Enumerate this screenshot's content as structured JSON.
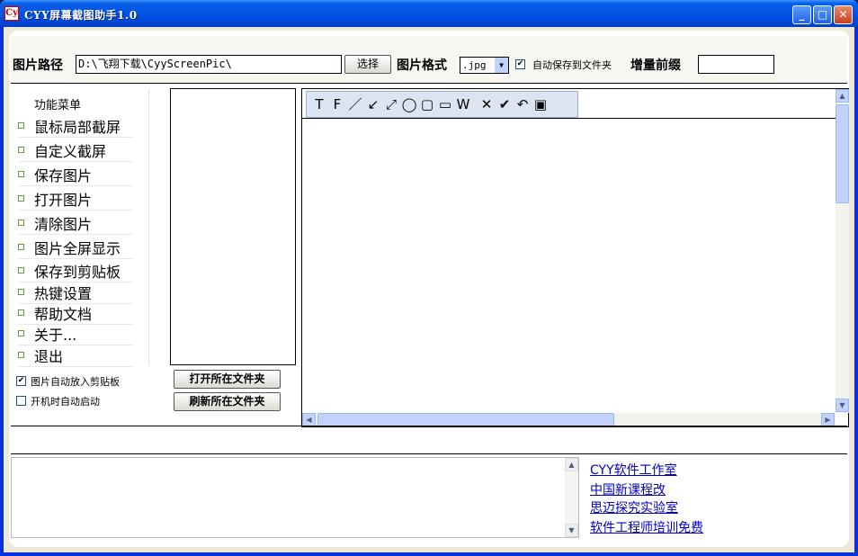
{
  "window": {
    "title": "CYY屏幕截图助手1.0"
  },
  "topbar": {
    "path_label": "图片路径",
    "path_value": "D:\\飞翔下载\\CyyScreenPic\\",
    "browse_button": "选择",
    "format_label": "图片格式",
    "format_value": ".jpg",
    "autosave_label": "自动保存到文件夹",
    "autosave_checked": true,
    "prefix_label": "增量前缀",
    "prefix_value": ""
  },
  "menu": {
    "title": "功能菜单",
    "items": [
      "鼠标局部截屏",
      "自定义截屏",
      "保存图片",
      "打开图片",
      "清除图片",
      "图片全屏显示",
      "保存到剪贴板",
      "热键设置",
      "帮助文档",
      "关于...",
      "退出"
    ]
  },
  "options": {
    "auto_clipboard": {
      "label": "图片自动放入剪贴板",
      "checked": true
    },
    "autostart": {
      "label": "开机时自动启动",
      "checked": false
    }
  },
  "folder_buttons": {
    "open": "打开所在文件夹",
    "refresh": "刷新所在文件夹"
  },
  "toolbar": {
    "tools": [
      {
        "name": "text-tool-icon",
        "glyph": "T"
      },
      {
        "name": "font-tool-icon",
        "glyph": "F"
      },
      {
        "name": "line-tool-icon",
        "glyph": "／"
      },
      {
        "name": "arrow-down-left-tool-icon",
        "glyph": "↙"
      },
      {
        "name": "double-arrow-tool-icon",
        "glyph": "⤢"
      },
      {
        "name": "ellipse-tool-icon",
        "glyph": "◯"
      },
      {
        "name": "rounded-rect-tool-icon",
        "glyph": "▢"
      },
      {
        "name": "rectangle-tool-icon",
        "glyph": "▭"
      },
      {
        "name": "line-width-tool-icon",
        "glyph": "W"
      },
      {
        "name": "delete-icon",
        "glyph": "✕"
      },
      {
        "name": "confirm-icon",
        "glyph": "✔"
      },
      {
        "name": "undo-icon",
        "glyph": "↶"
      },
      {
        "name": "save-disk-icon",
        "glyph": "▣"
      }
    ]
  },
  "links": [
    "CYY软件工作室",
    "中国新课程改",
    "思迈探究实验室",
    "软件工程师培训免费"
  ],
  "colors": {
    "title_bar": "#0054e3",
    "link": "#0000c8",
    "client_bg": "#ece9d8"
  }
}
